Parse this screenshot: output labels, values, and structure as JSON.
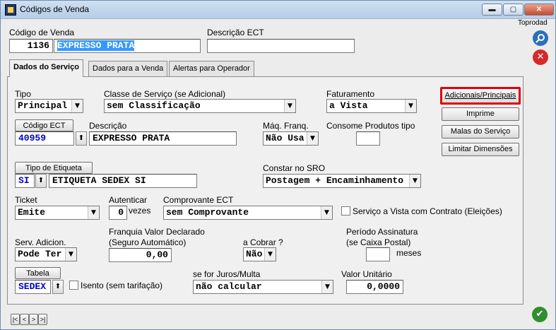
{
  "window": {
    "title": "Códigos de Venda",
    "min": "▬",
    "max": "▢",
    "close": "✕"
  },
  "header": {
    "codigo_label": "Código de Venda",
    "codigo_value": "1136",
    "nome_value": "EXPRESSO PRATA",
    "descricao_ect_label": "Descrição ECT",
    "descricao_ect_value": "",
    "toprodad": "Toprodad"
  },
  "tabs": [
    {
      "label": "Dados do Serviço"
    },
    {
      "label": "Dados para a Venda"
    },
    {
      "label": "Alertas para Operador"
    }
  ],
  "form": {
    "tipo_label": "Tipo",
    "tipo_value": "Principal",
    "classe_label": "Classe de Serviço (se Adicional)",
    "classe_value": "sem Classificação",
    "faturamento_label": "Faturamento",
    "faturamento_value": "a Vista",
    "codigo_ect_button": "Código ECT",
    "codigo_ect_value": "40959",
    "descricao_label": "Descrição",
    "descricao_value": "EXPRESSO PRATA",
    "maq_label": "Máq. Franq.",
    "maq_value": "Não Usa",
    "consome_label": "Consome Produtos tipo",
    "consome_value": "",
    "etiqueta_button": "Tipo de Etiqueta",
    "etiqueta_code": "SI",
    "etiqueta_value": "ETIQUETA SEDEX SI",
    "sro_label": "Constar no SRO",
    "sro_value": "Postagem + Encaminhamento",
    "ticket_label": "Ticket",
    "ticket_value": "Emite",
    "autenticar_label": "Autenticar",
    "autenticar_value": "0",
    "vezes_label": "vezes",
    "comprovante_label": "Comprovante ECT",
    "comprovante_value": "sem Comprovante",
    "servico_vista_label": "Serviço a Vista com Contrato (Eleições)",
    "serv_adicion_label": "Serv. Adicion.",
    "serv_adicion_value": "Pode Ter",
    "franquia_label1": "Franquia Valor Declarado",
    "franquia_label2": "(Seguro Automático)",
    "franquia_value": "0,00",
    "cobrar_label": "a Cobrar ?",
    "cobrar_value": "Não",
    "periodo_label1": "Período Assinatura",
    "periodo_label2": "(se Caixa Postal)",
    "periodo_value": "",
    "meses_label": "meses",
    "tabela_button": "Tabela",
    "tabela_value": "SEDEX",
    "isento_label": "Isento (sem tarifação)",
    "juros_label": "se for Juros/Multa",
    "juros_value": "não calcular",
    "valor_unitario_label": "Valor Unitário",
    "valor_unitario_value": "0,0000"
  },
  "side_buttons": {
    "adicionais": "Adicionais/Principais",
    "imprime": "Imprime",
    "malas": "Malas do Serviço",
    "limitar": "Limitar Dimensões"
  },
  "nav": [
    "|<",
    "<",
    ">",
    ">|"
  ],
  "icons": {
    "search": "search-icon",
    "cancel": "cancel-icon",
    "confirm": "check-icon"
  },
  "colors": {
    "highlight_border": "#e0000c",
    "blue_text": "#0000c0",
    "selection": "#3399ff",
    "cancel": "#d42a2a",
    "confirm": "#2f8f2f"
  }
}
